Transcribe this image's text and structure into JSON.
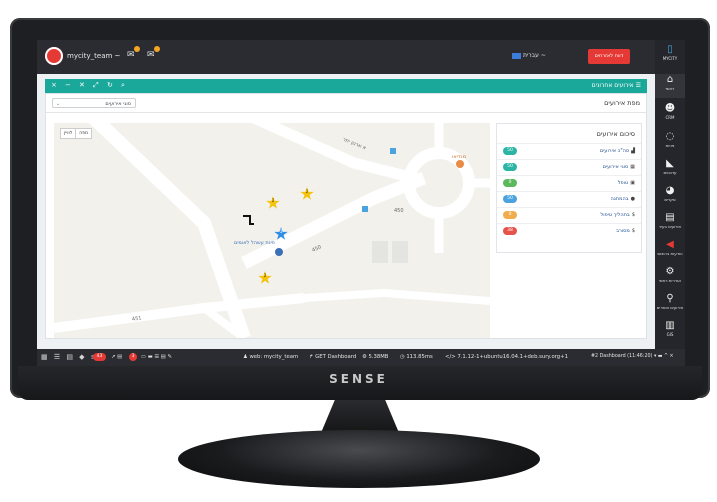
{
  "header": {
    "team_name": "mycity_team ~",
    "language": "עברית ~",
    "report_button": "דווח לאזרחים"
  },
  "sidebar": {
    "logo": "MYCITY",
    "items": [
      {
        "label": "ראשי",
        "icon": "home-icon"
      },
      {
        "label": "CRM",
        "icon": "users-icon"
      },
      {
        "label": "פניות",
        "icon": "chat-icon"
      },
      {
        "label": "עדכונים",
        "icon": "rss-icon"
      },
      {
        "label": "סקרים",
        "icon": "pie-icon"
      },
      {
        "label": "אירועים בעיר",
        "icon": "calendar-icon"
      },
      {
        "label": "הודעות בהיבוס",
        "icon": "megaphone-icon"
      },
      {
        "label": "הגדרות ראשי",
        "icon": "gears-icon"
      },
      {
        "label": "אירועים ואתרים",
        "icon": "pin-icon"
      },
      {
        "label": "GIS",
        "icon": "map-icon"
      }
    ]
  },
  "panel": {
    "title": "אירועים אחרונים",
    "map_title": "מפת אירועים",
    "type_select": "סוגי אירועים",
    "map_toggle": [
      "מפה",
      "לוויין"
    ]
  },
  "map": {
    "road_labels": [
      "א ארנון יתר",
      "450",
      "450",
      "451"
    ],
    "poi_labels": [
      "מגדיאו",
      "פינת עשהל לאומים"
    ],
    "pins": [
      "2",
      "2",
      "1",
      "2"
    ]
  },
  "summary": {
    "title": "סיכום אירועים",
    "rows": [
      {
        "label": "סה\"כ אירועים",
        "count": "50",
        "color": "#2bb5a5"
      },
      {
        "label": "סוגי אירועים",
        "count": "50",
        "color": "#2bb5a5"
      },
      {
        "label": "טופל",
        "count": "0",
        "color": "#5cb85c"
      },
      {
        "label": "בהמתנה",
        "count": "50",
        "color": "#4aa3df"
      },
      {
        "label": "בתהליך טיפול",
        "count": "0",
        "color": "#f0ad4e"
      },
      {
        "label": "מסורב",
        "count": "38",
        "color": "#e5534b"
      }
    ]
  },
  "statusbar": {
    "alert_count": "43",
    "alert_count2": "3",
    "user": "web: mycity_team",
    "request": "GET Dashboard",
    "memory": "5.38MB",
    "time": "113.85ms",
    "version": "7.1.12-1+ubuntu16.04.1+deb.sury.org+1",
    "dashboard": "#2 Dashboard (11:46:20)"
  },
  "monitor": {
    "brand": "SENSE"
  }
}
